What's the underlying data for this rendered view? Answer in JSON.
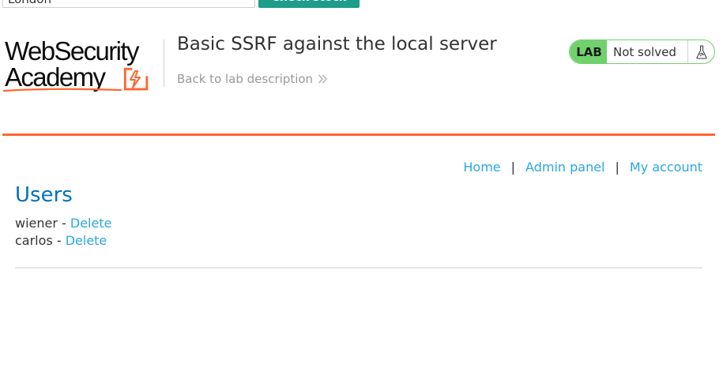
{
  "stock_check": {
    "selected_store": "London",
    "button_label": "Check stock"
  },
  "header": {
    "logo_line1": "WebSecurity",
    "logo_line2": "Academy",
    "lab_title": "Basic SSRF against the local server",
    "back_link": "Back to lab description",
    "lab_badge": "LAB",
    "lab_status": "Not solved"
  },
  "nav": {
    "home": "Home",
    "separator": "|",
    "admin_panel": "Admin panel",
    "my_account": "My account"
  },
  "users_section": {
    "heading": "Users",
    "users": [
      {
        "name": "wiener",
        "separator": " - ",
        "action": "Delete"
      },
      {
        "name": "carlos",
        "separator": " - ",
        "action": "Delete"
      }
    ]
  },
  "colors": {
    "accent_orange": "#ff6633",
    "link_blue": "#29a8e0",
    "heading_blue": "#0071bc",
    "lab_green": "#70d16d",
    "button_teal": "#1d9d8a"
  }
}
